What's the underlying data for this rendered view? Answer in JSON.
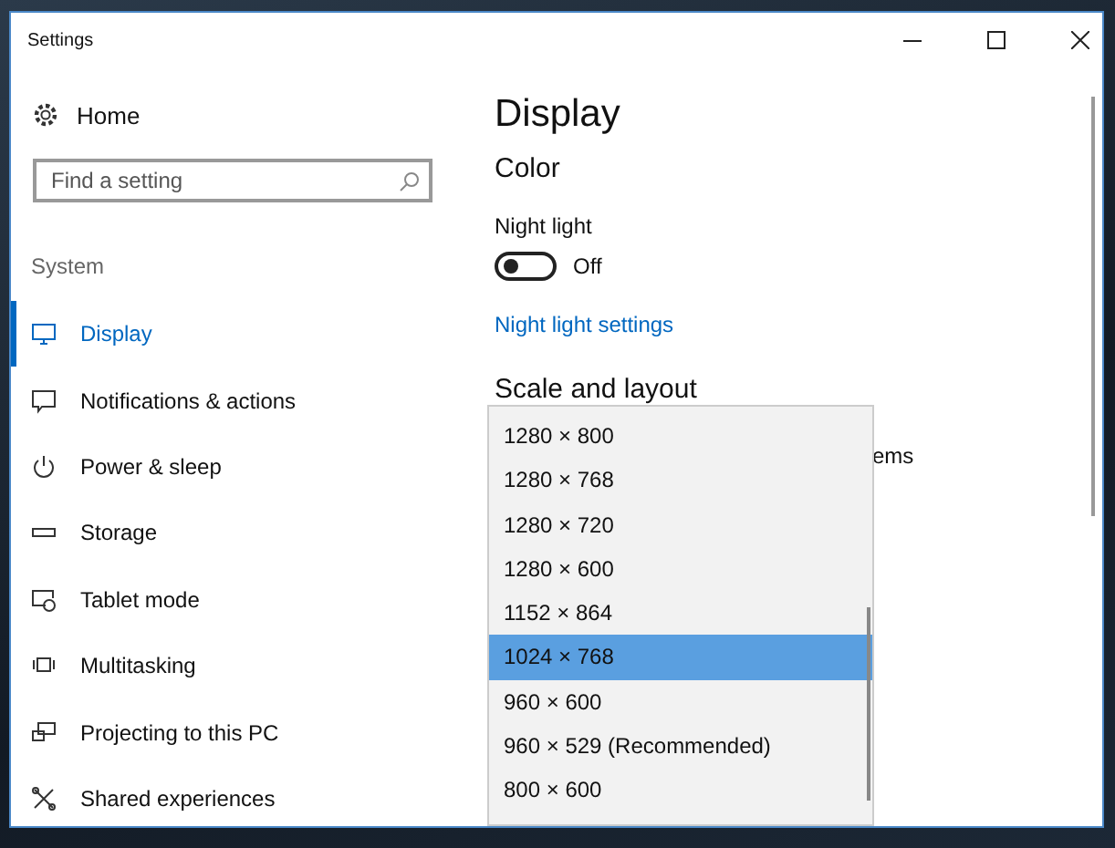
{
  "window": {
    "title": "Settings"
  },
  "sidebar": {
    "home": "Home",
    "search": {
      "placeholder": "Find a setting"
    },
    "section": "System",
    "items": [
      {
        "label": "Display",
        "selected": true
      },
      {
        "label": "Notifications & actions",
        "selected": false
      },
      {
        "label": "Power & sleep",
        "selected": false
      },
      {
        "label": "Storage",
        "selected": false
      },
      {
        "label": "Tablet mode",
        "selected": false
      },
      {
        "label": "Multitasking",
        "selected": false
      },
      {
        "label": "Projecting to this PC",
        "selected": false
      },
      {
        "label": "Shared experiences",
        "selected": false
      }
    ]
  },
  "content": {
    "title": "Display",
    "color_heading": "Color",
    "night_light": {
      "label": "Night light",
      "on": false,
      "state_text": "Off"
    },
    "link": "Night light settings",
    "scale_heading": "Scale and layout",
    "partial_text": "ems"
  },
  "resolution_dropdown": {
    "options": [
      {
        "label": "1280 × 800",
        "selected": false
      },
      {
        "label": "1280 × 768",
        "selected": false
      },
      {
        "label": "1280 × 720",
        "selected": false
      },
      {
        "label": "1280 × 600",
        "selected": false
      },
      {
        "label": "1152 × 864",
        "selected": false
      },
      {
        "label": "1024 × 768",
        "selected": true
      },
      {
        "label": "960 × 600",
        "selected": false
      },
      {
        "label": "960 × 529 (Recommended)",
        "selected": false
      },
      {
        "label": "800 × 600",
        "selected": false
      }
    ]
  }
}
